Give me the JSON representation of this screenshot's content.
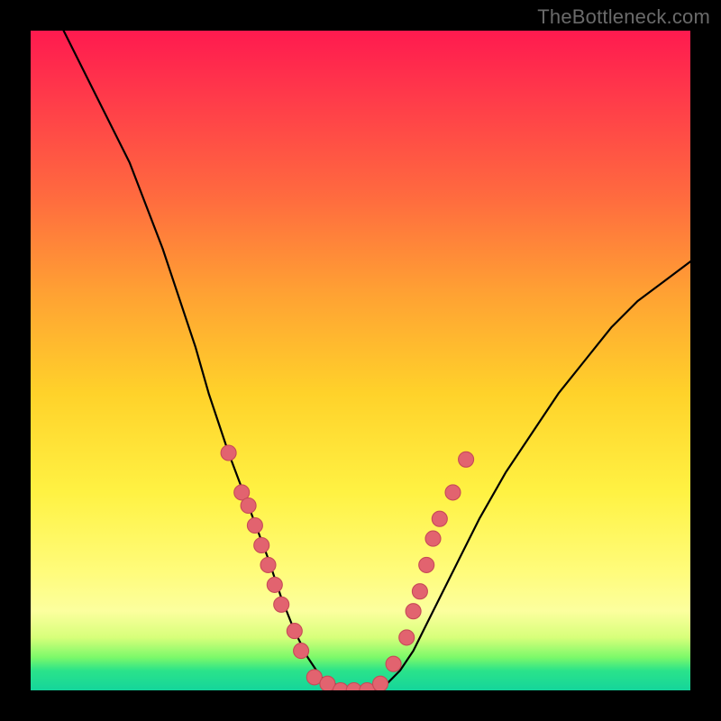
{
  "watermark": "TheBottleneck.com",
  "colors": {
    "page_bg": "#000000",
    "gradient_top": "#ff1a4f",
    "gradient_mid": "#fff243",
    "gradient_bottom": "#14d59b",
    "curve": "#000000",
    "dot_fill": "#e2636f",
    "dot_stroke": "#c74a57"
  },
  "chart_data": {
    "type": "line",
    "title": "",
    "xlabel": "",
    "ylabel": "",
    "xlim": [
      0,
      100
    ],
    "ylim": [
      0,
      100
    ],
    "grid": false,
    "legend": false,
    "series": [
      {
        "name": "bottleneck-curve",
        "x": [
          5,
          10,
          15,
          20,
          25,
          27,
          30,
          33,
          36,
          38,
          40,
          42,
          44,
          46,
          48,
          50,
          52,
          54,
          56,
          58,
          60,
          64,
          68,
          72,
          76,
          80,
          84,
          88,
          92,
          96,
          100
        ],
        "y": [
          100,
          90,
          80,
          67,
          52,
          45,
          36,
          28,
          20,
          14,
          9,
          5,
          2,
          1,
          0,
          0,
          0,
          1,
          3,
          6,
          10,
          18,
          26,
          33,
          39,
          45,
          50,
          55,
          59,
          62,
          65
        ]
      }
    ],
    "points": [
      {
        "name": "left-cluster",
        "x": 30,
        "y": 36
      },
      {
        "name": "left-cluster",
        "x": 32,
        "y": 30
      },
      {
        "name": "left-cluster",
        "x": 33,
        "y": 28
      },
      {
        "name": "left-cluster",
        "x": 34,
        "y": 25
      },
      {
        "name": "left-cluster",
        "x": 35,
        "y": 22
      },
      {
        "name": "left-cluster",
        "x": 36,
        "y": 19
      },
      {
        "name": "left-cluster",
        "x": 37,
        "y": 16
      },
      {
        "name": "left-cluster",
        "x": 38,
        "y": 13
      },
      {
        "name": "left-cluster",
        "x": 40,
        "y": 9
      },
      {
        "name": "left-cluster",
        "x": 41,
        "y": 6
      },
      {
        "name": "bottom-flat",
        "x": 43,
        "y": 2
      },
      {
        "name": "bottom-flat",
        "x": 45,
        "y": 1
      },
      {
        "name": "bottom-flat",
        "x": 47,
        "y": 0
      },
      {
        "name": "bottom-flat",
        "x": 49,
        "y": 0
      },
      {
        "name": "bottom-flat",
        "x": 51,
        "y": 0
      },
      {
        "name": "bottom-flat",
        "x": 53,
        "y": 1
      },
      {
        "name": "right-cluster",
        "x": 55,
        "y": 4
      },
      {
        "name": "right-cluster",
        "x": 57,
        "y": 8
      },
      {
        "name": "right-cluster",
        "x": 58,
        "y": 12
      },
      {
        "name": "right-cluster",
        "x": 59,
        "y": 15
      },
      {
        "name": "right-cluster",
        "x": 60,
        "y": 19
      },
      {
        "name": "right-cluster",
        "x": 61,
        "y": 23
      },
      {
        "name": "right-cluster",
        "x": 62,
        "y": 26
      },
      {
        "name": "right-cluster",
        "x": 64,
        "y": 30
      },
      {
        "name": "right-cluster",
        "x": 66,
        "y": 35
      }
    ]
  }
}
